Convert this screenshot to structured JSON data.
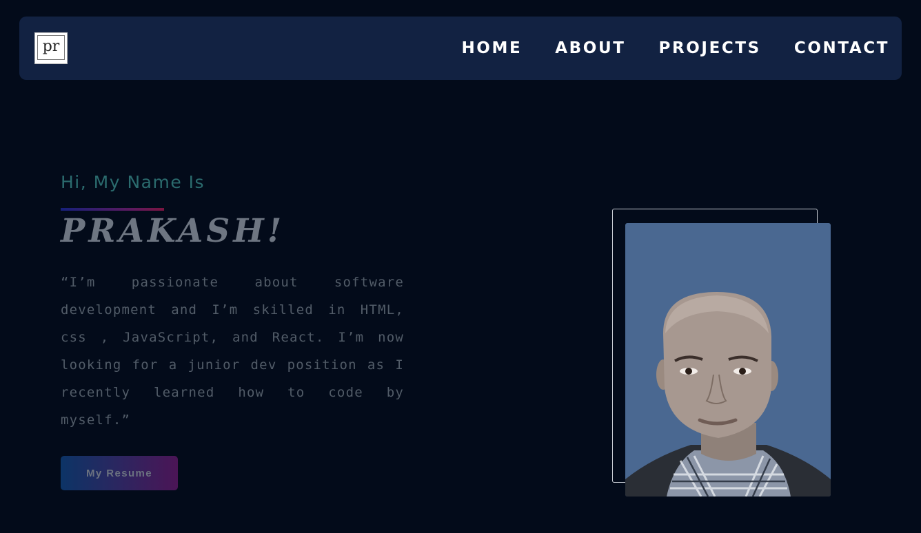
{
  "navbar": {
    "logo_text": "pr",
    "links": [
      {
        "label": "HOME"
      },
      {
        "label": "ABOUT"
      },
      {
        "label": "PROJECTS"
      },
      {
        "label": "CONTACT"
      }
    ]
  },
  "hero": {
    "greeting": "Hi, My Name Is",
    "name": "PRAKASH!",
    "bio": "“I’m passionate about software development and I’m skilled in HTML, css , JavaScript, and React. I’m now looking for a junior dev position as I recently learned how to code by myself.”",
    "resume_button": "My Resume"
  },
  "colors": {
    "background": "#030b1a",
    "navbar": "#122242",
    "greeting": "#2b6b6e",
    "photo_background": "#4a6891"
  }
}
